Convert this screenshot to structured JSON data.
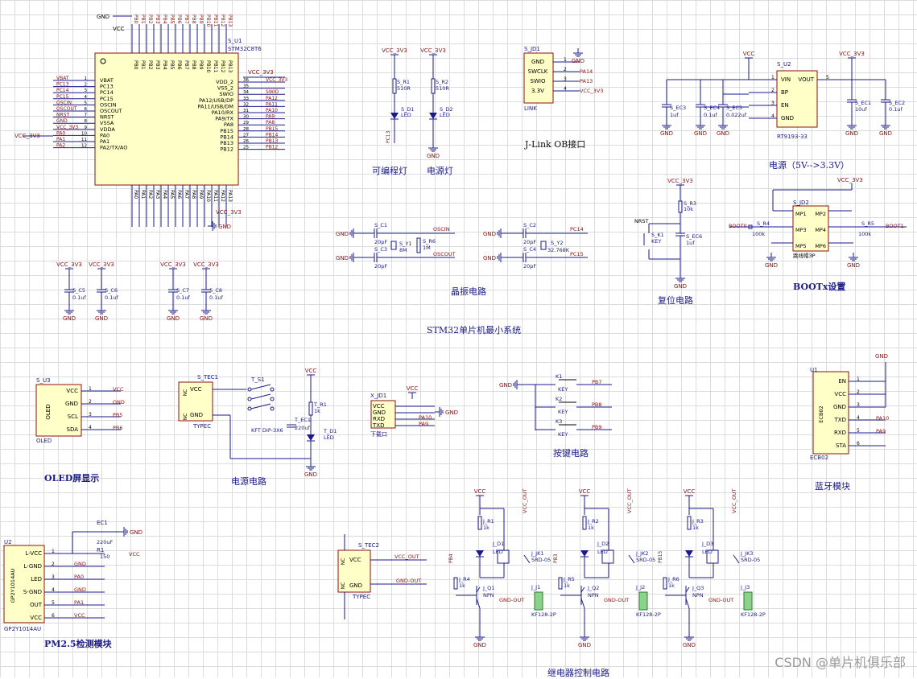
{
  "mcu": {
    "ref": "S_U1",
    "part": "STM32C8T6",
    "gnd": "GND",
    "vcc": "VCC",
    "vcc3v3": "VCC_3V3",
    "left_pins": [
      "VBAT",
      "PC13",
      "PC14",
      "PC15",
      "OSCIN",
      "OSCOUT",
      "NRST",
      "VSSA",
      "VDDA",
      "PA0",
      "PA1",
      "PA2/TX/AO"
    ],
    "left_nets": [
      "VBAT",
      "PC13",
      "PC14",
      "PC15",
      "OSCIN",
      "OSCOUT",
      "NRST",
      "GND",
      "VCC_3V3",
      "PA0",
      "PA1",
      "PA2"
    ],
    "right_pins": [
      "VDD_2",
      "VSS_2",
      "SWIO",
      "PA12/USB/DP",
      "PA11/USB/DM",
      "PA10/RX",
      "PA9/TX",
      "PA8",
      "PB15",
      "PB14",
      "PB13",
      "PB12"
    ],
    "right_nets": [
      "VCC_3V3",
      "",
      "SWIO",
      "PA12",
      "PA11",
      "PA10",
      "PA9",
      "PA8",
      "PB15",
      "PB14",
      "PB13",
      "PB12"
    ]
  },
  "jlink": {
    "ref": "S_JD1",
    "name": "LINK",
    "pins": [
      "GND",
      "SWCLK",
      "SWIO",
      "3.3V"
    ],
    "nets": [
      "GND",
      "PA14",
      "PA13",
      "VCC_3V3"
    ],
    "title": "J-Link OB接口"
  },
  "leds": {
    "r1": "S_R1",
    "r1v": "510R",
    "r2": "S_R2",
    "r2v": "510R",
    "d1": "S_D1",
    "d2": "S_D2",
    "led": "LED",
    "net": "PC13",
    "vcc": "VCC_3V3",
    "gnd": "GND",
    "title1": "可编程灯",
    "title2": "电源灯"
  },
  "power": {
    "ref": "S_U2",
    "part": "RT9193-33",
    "pins": [
      "VIN",
      "BP",
      "EN",
      "GND"
    ],
    "out": "VOUT",
    "vcc": "VCC",
    "vcc3v3": "VCC_3V3",
    "caps": [
      {
        "ref": "S_EC3",
        "val": "1uf"
      },
      {
        "ref": "S_EC4",
        "val": "0.1uf"
      },
      {
        "ref": "S_EC5",
        "val": "0.022uf"
      },
      {
        "ref": "S_EC1",
        "val": "10uf"
      },
      {
        "ref": "S_EC2",
        "val": "0.1uf"
      }
    ],
    "title": "电源（5V-->3.3V）"
  },
  "crystal": {
    "c1": "S_C1",
    "c2": "S_C3",
    "v": "20pF",
    "y1": "S_Y1",
    "y1v": "8M",
    "r6": "S_R6",
    "r6v": "1M",
    "net1": "OSCIN",
    "net2": "OSCOUT",
    "c3": "S_C2",
    "c4": "S_C4",
    "y2": "S_Y2",
    "y2v": "32.768K",
    "net3": "PC14",
    "net4": "PC15",
    "title": "晶振电路"
  },
  "reset": {
    "r": "S_R3",
    "rv": "10k",
    "k": "S_K1",
    "kv": "KEY",
    "cap": "S_EC6",
    "capv": "1uf",
    "net": "NRST",
    "vcc": "VCC_3V3",
    "title": "复位电路"
  },
  "boot": {
    "ref": "S_JD2",
    "pins": [
      "MP1",
      "MP2",
      "MP3",
      "MP4",
      "MP5",
      "MP6"
    ],
    "r4": "S_R4",
    "r5": "S_R5",
    "rv": "100k",
    "net0": "BOOT0",
    "net1": "BOOT1",
    "jumper": "跳线帽3P",
    "title": "BOOTx设置"
  },
  "system_title": "STM32单片机最小系统",
  "oled": {
    "ref": "S_U3",
    "name": "OLED",
    "pins": [
      "VCC",
      "GND",
      "SCL",
      "SDA"
    ],
    "nets": [
      "VCC",
      "GND",
      "PB5",
      "PB6"
    ],
    "title": "OLED屏显示"
  },
  "tec1": {
    "ref": "S_TEC1",
    "part": "TYPEC",
    "pins": [
      "VCC",
      "GND"
    ],
    "sw": "T_S1",
    "swv": "KFT DIP-3X6",
    "r": "T_R1",
    "rv": "1k",
    "cap": "T_EC1",
    "capv": "220uf",
    "d": "T_D1",
    "dv": "LED",
    "vcc": "VCC",
    "gnd": "GND",
    "title": "电源电路",
    "nc": "NC"
  },
  "uart": {
    "ref": "X_JD1",
    "name": "下载口",
    "pins": [
      "VCC",
      "GND",
      "RXD",
      "TXD"
    ],
    "nets": [
      "VCC",
      "GND",
      "PA10",
      "PA9"
    ]
  },
  "keys": {
    "refs": [
      "K1",
      "K2",
      "K3"
    ],
    "v": "KEY",
    "nets": [
      "PB7",
      "PB8",
      "PB9"
    ],
    "gnd": "GND",
    "title": "按键电路"
  },
  "bt": {
    "ref": "U1",
    "part": "ECB02",
    "pins": [
      "EN",
      "VCC",
      "GND",
      "TXD",
      "RXD",
      "STA"
    ],
    "nets": [
      "",
      "",
      "",
      "PA10",
      "PA9",
      ""
    ],
    "gnd": "GND",
    "title": "蓝牙模块"
  },
  "pm": {
    "ref": "U2",
    "part": "GP2Y1014AU",
    "pins": [
      "L-VCC",
      "L-GND",
      "LED",
      "S-GND",
      "OUT",
      "VCC"
    ],
    "nets": [
      "",
      "GND",
      "PA0",
      "GND",
      "PA1",
      "VCC"
    ],
    "ec": "EC1",
    "ecv": "220uF",
    "r": "R1",
    "rv": "150",
    "title": "PM2.5检测模块"
  },
  "tec2": {
    "ref": "S_TEC2",
    "part": "TYPEC",
    "pins": [
      "VCC",
      "GND"
    ],
    "nets": [
      "VCC_OUT",
      "GND-OUT"
    ],
    "nc": "NC"
  },
  "relays": [
    {
      "r1": "J_R1",
      "r2": "J_R4",
      "d": "J_D1",
      "q": "J_Q1",
      "jk": "J_JK1",
      "j": "J_J1",
      "net": "PB4"
    },
    {
      "r1": "J_R2",
      "r2": "J_R5",
      "d": "J_D2",
      "q": "J_Q2",
      "jk": "J_JK2",
      "j": "J_J2",
      "net": "PB3"
    },
    {
      "r1": "J_R3",
      "r2": "J_R6",
      "d": "J_D3",
      "q": "J_Q3",
      "jk": "J_JK3",
      "j": "J_J3",
      "net": "PB15"
    }
  ],
  "relay_common": {
    "rv": "1k",
    "q": "NPN",
    "jkv": "SRD-05",
    "jv": "KF128-2P",
    "vcc": "VCC",
    "vccout": "VCC_OUT",
    "gndout": "GND-OUT",
    "gnd": "GND",
    "led": "LED",
    "title": "继电器控制电路"
  },
  "watermark": "CSDN @单片机俱乐部"
}
